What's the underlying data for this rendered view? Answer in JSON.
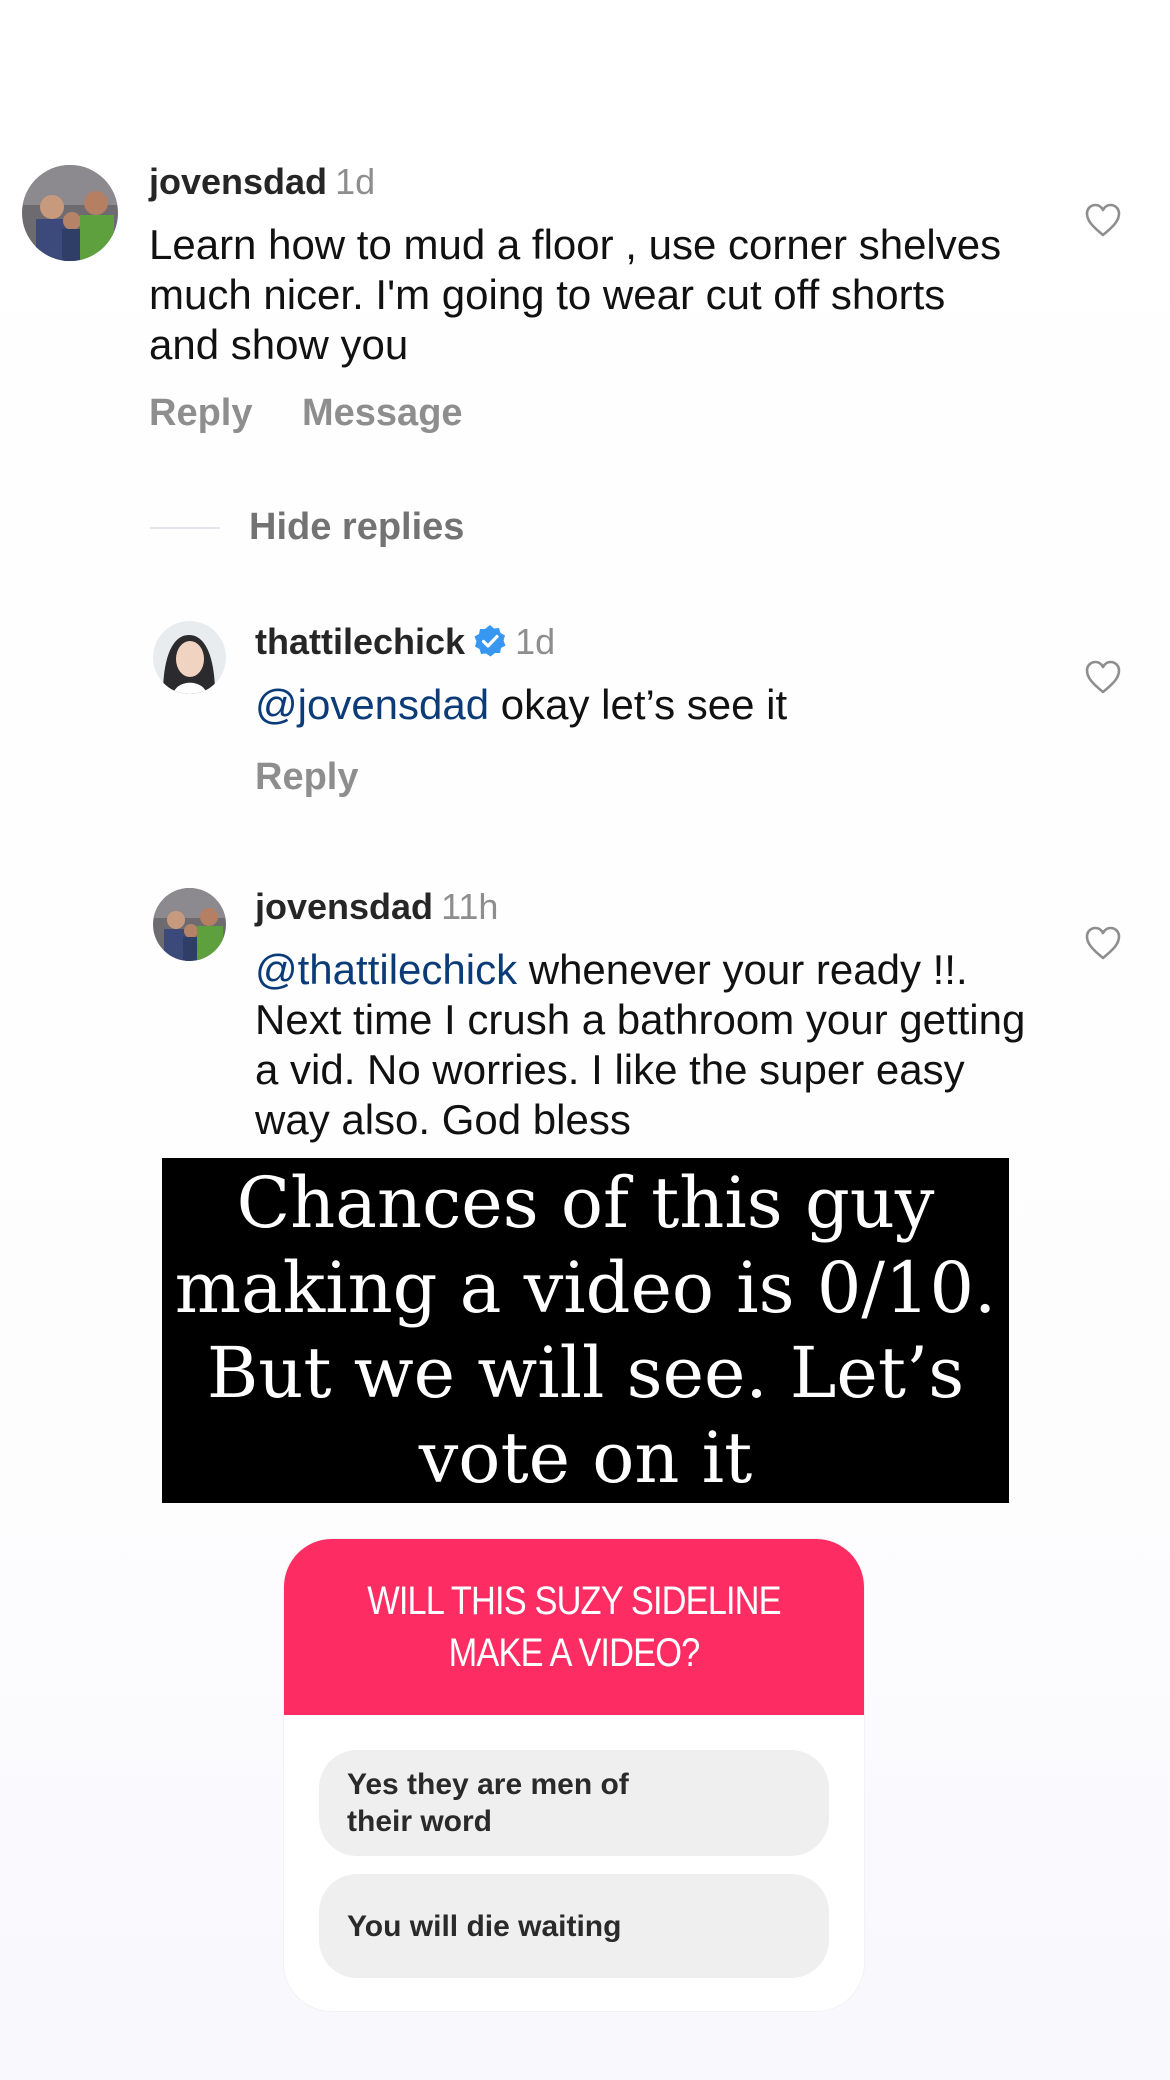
{
  "comments": {
    "c1": {
      "username": "jovensdad",
      "time": "1d",
      "text": "Learn how to mud a floor , use corner shelves much nicer.  I'm going to wear cut off shorts and show you",
      "reply_label": "Reply",
      "message_label": "Message",
      "hide_replies_label": "Hide replies"
    },
    "c2": {
      "username": "thattilechick",
      "time": "1d",
      "mention": "@jovensdad",
      "text": " okay let’s see it",
      "reply_label": "Reply"
    },
    "c3": {
      "username": "jovensdad",
      "time": "11h",
      "mention": "@thattilechick",
      "text": " whenever your ready !!.  Next time I crush a bathroom your getting a vid.  No worries.  I like the super easy way also.  God bless"
    }
  },
  "caption": {
    "text": "Chances of this guy making a video is 0/10. But we will see. Let’s vote on it"
  },
  "poll": {
    "question": "WILL THIS SUZY SIDELINE MAKE A VIDEO?",
    "options": [
      "Yes they are men of their word",
      "You will die waiting"
    ]
  },
  "colors": {
    "poll_header": "#fd2d64",
    "mention": "#0c3c78",
    "verified": "#3897f0",
    "muted": "#8e8e8e"
  },
  "icons": [
    "heart-icon",
    "verified-badge-icon"
  ]
}
